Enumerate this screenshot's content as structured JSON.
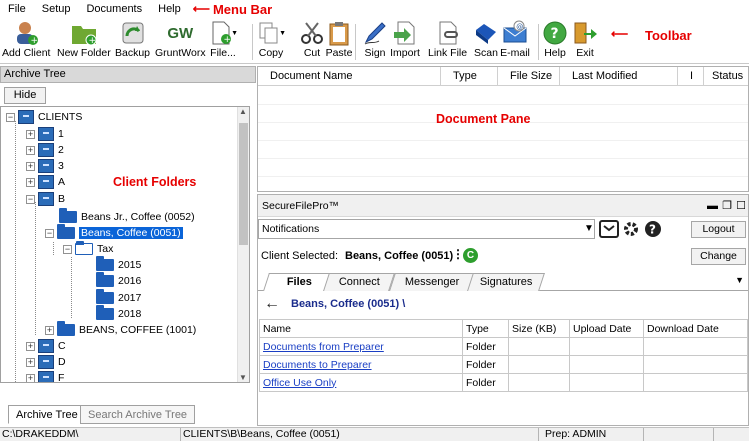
{
  "menu": {
    "items": [
      "File",
      "Setup",
      "Documents",
      "Help"
    ],
    "annotation": "Menu Bar"
  },
  "toolbar": {
    "annotation": "Toolbar",
    "buttons": [
      "Add Client",
      "New Folder",
      "Backup",
      "GruntWorx",
      "File...",
      "Copy",
      "Cut",
      "Paste",
      "Sign",
      "Import",
      "Link File",
      "Scan",
      "E-mail",
      "Help",
      "Exit"
    ],
    "gruntworx_logo": "GW"
  },
  "archive": {
    "header": "Archive Tree",
    "hide_label": "Hide",
    "annotation": "Client Folders",
    "tree": {
      "root": "CLIENTS",
      "nodes": [
        "1",
        "2",
        "3",
        "A",
        "B",
        "C",
        "D",
        "F"
      ],
      "b_children": [
        "Beans Jr., Coffee (0052)",
        "Beans, Coffee (0051)",
        "BEANS, COFFEE (1001)"
      ],
      "tax_label": "Tax",
      "years": [
        "2015",
        "2016",
        "2017",
        "2018"
      ]
    },
    "tabs": [
      "Archive Tree",
      "Search Archive Tree"
    ]
  },
  "document_pane": {
    "annotation": "Document Pane",
    "columns": [
      "Document Name",
      "Type",
      "File Size",
      "Last Modified",
      "I",
      "Status"
    ]
  },
  "securefile": {
    "title": "SecureFilePro™",
    "notifications_label": "Notifications",
    "logout_label": "Logout",
    "change_label": "Change",
    "client_selected_label": "Client Selected:",
    "client_name": "Beans, Coffee (0051)",
    "client_badge": "C",
    "tabs": [
      "Files",
      "Connect",
      "Messenger",
      "Signatures"
    ],
    "breadcrumb": "Beans, Coffee (0051) \\",
    "table": {
      "columns": [
        "Name",
        "Type",
        "Size (KB)",
        "Upload Date",
        "Download Date"
      ],
      "rows": [
        {
          "name": "Documents from Preparer",
          "type": "Folder"
        },
        {
          "name": "Documents to Preparer",
          "type": "Folder"
        },
        {
          "name": "Office Use Only",
          "type": "Folder"
        }
      ]
    }
  },
  "statusbar": {
    "path": "C:\\DRAKEDDM\\",
    "location": "CLIENTS\\B\\Beans, Coffee (0051)",
    "prep": "Prep: ADMIN"
  },
  "colors": {
    "annotation": "#e60000",
    "selection": "#0a64d8",
    "folder": "#1f5fb8",
    "link": "#1a3fc4",
    "badge": "#2e9e2e"
  }
}
